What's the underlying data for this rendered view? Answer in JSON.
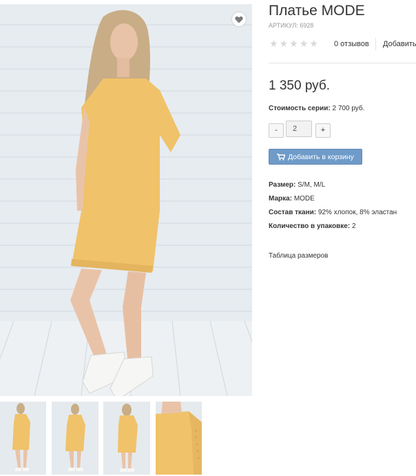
{
  "product": {
    "title": "Платье MODE",
    "sku": "АРТИКУЛ: 6928",
    "rating": {
      "stars_filled": 0,
      "stars_total": 5,
      "reviews_label": "0 отзывов",
      "add_review_label": "Добавить"
    },
    "price": "1 350 руб.",
    "series": {
      "label": "Стоимость серии:",
      "value": "2 700 руб."
    },
    "quantity": {
      "minus": "-",
      "value": "2",
      "plus": "+"
    },
    "cart_button_label": "Добавить в корзину",
    "attributes": [
      {
        "label": "Размер:",
        "value": "S/M, M/L"
      },
      {
        "label": "Марка:",
        "value": "MODE"
      },
      {
        "label": "Состав ткани:",
        "value": "92% хлопок, 8% эластан"
      },
      {
        "label": "Количество в упаковке:",
        "value": "2"
      }
    ],
    "size_table_link": "Таблица размеров"
  },
  "gallery": {
    "thumbnail_count": 4
  },
  "colors": {
    "dress": "#f0c26a",
    "button": "#6f9bc8",
    "star_empty": "#d9d9d9",
    "heart": "#7a7a7a"
  },
  "icons": {
    "favorite": "heart-icon",
    "cart": "cart-icon",
    "star": "star-icon"
  }
}
